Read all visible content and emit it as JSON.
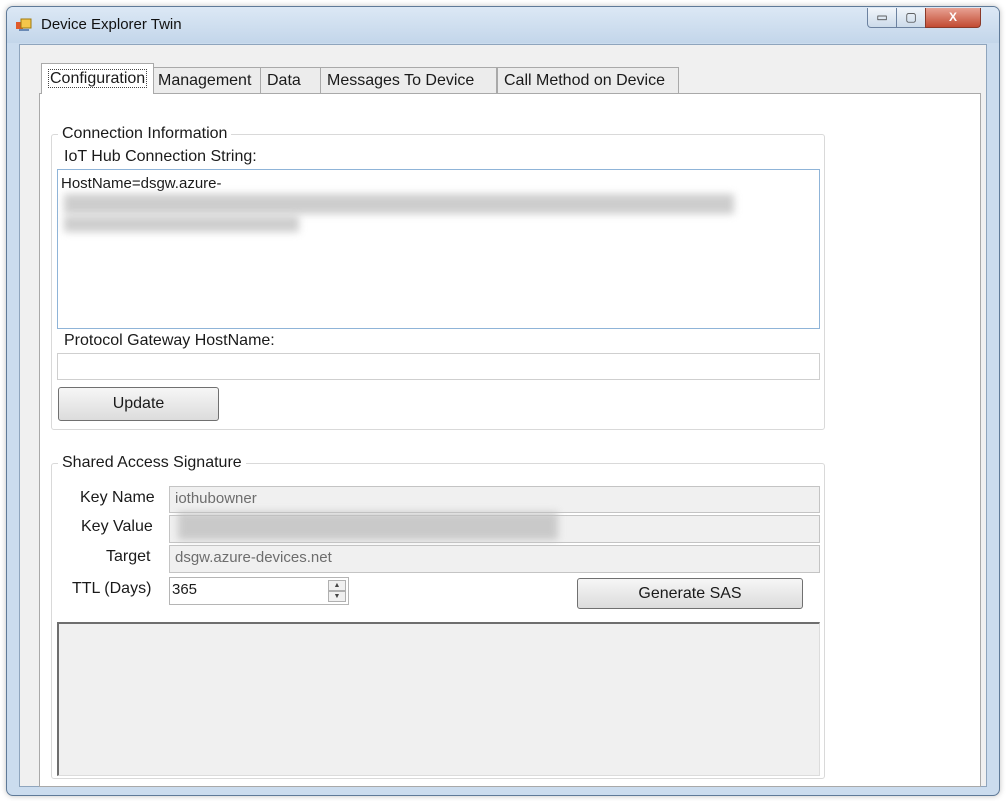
{
  "window": {
    "title": "Device Explorer Twin",
    "controls": {
      "minimize": "▭",
      "maximize": "▢",
      "close": "X"
    }
  },
  "tabs": [
    {
      "label": "Configuration",
      "active": true
    },
    {
      "label": "Management",
      "active": false
    },
    {
      "label": "Data",
      "active": false
    },
    {
      "label": "Messages To Device",
      "active": false
    },
    {
      "label": "Call Method on Device",
      "active": false
    }
  ],
  "connection": {
    "group_label": "Connection Information",
    "conn_string_label": "IoT Hub Connection String:",
    "conn_string_value": "HostName=dsgw.azure-",
    "gateway_label": "Protocol Gateway HostName:",
    "gateway_value": "",
    "update_label": "Update"
  },
  "sas": {
    "group_label": "Shared Access Signature",
    "key_name_label": "Key Name",
    "key_name_value": "iothubowner",
    "key_value_label": "Key Value",
    "target_label": "Target",
    "target_value": "dsgw.azure-devices.net",
    "ttl_label": "TTL (Days)",
    "ttl_value": "365",
    "generate_label": "Generate SAS",
    "output_value": ""
  }
}
